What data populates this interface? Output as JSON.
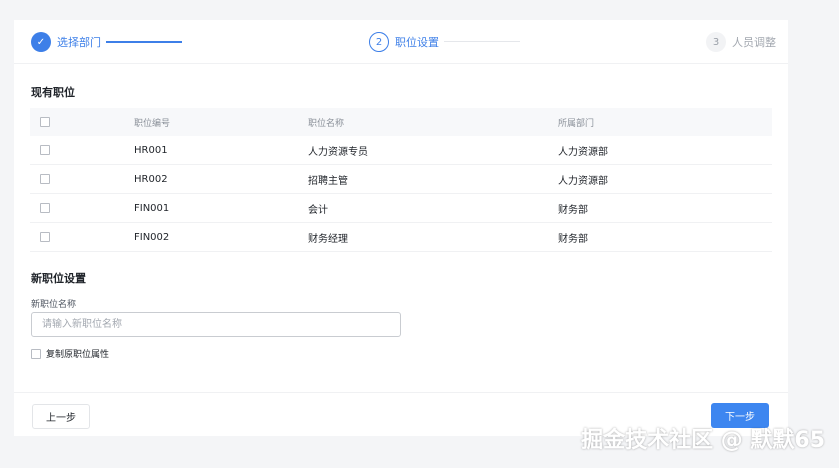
{
  "steps": [
    {
      "index": "✓",
      "label": "选择部门",
      "state": "done"
    },
    {
      "index": "2",
      "label": "职位设置",
      "state": "active"
    },
    {
      "index": "3",
      "label": "人员调整",
      "state": "wait"
    }
  ],
  "existing": {
    "title": "现有职位",
    "headers": {
      "code": "职位编号",
      "name": "职位名称",
      "dept": "所属部门"
    },
    "rows": [
      {
        "code": "HR001",
        "name": "人力资源专员",
        "dept": "人力资源部"
      },
      {
        "code": "HR002",
        "name": "招聘主管",
        "dept": "人力资源部"
      },
      {
        "code": "FIN001",
        "name": "会计",
        "dept": "财务部"
      },
      {
        "code": "FIN002",
        "name": "财务经理",
        "dept": "财务部"
      }
    ]
  },
  "new_position": {
    "title": "新职位设置",
    "name_label": "新职位名称",
    "name_value": "",
    "name_placeholder": "请输入新职位名称",
    "copy_label": "复制原职位属性"
  },
  "footer": {
    "prev_label": "上一步",
    "next_label": "下一步"
  },
  "watermark": "掘金技术社区 @ 默默65",
  "colors": {
    "primary": "#3d7fe8",
    "button": "#3d86f0",
    "background": "#f4f5f7"
  }
}
